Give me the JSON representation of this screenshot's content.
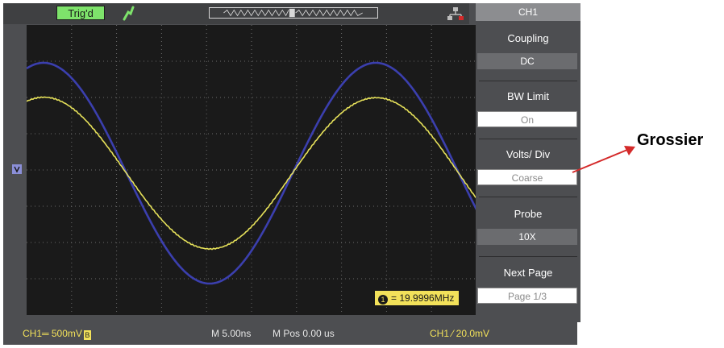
{
  "topbar": {
    "trigger_status": "Trig'd"
  },
  "menu": {
    "title": "CH1",
    "items": [
      {
        "label": "Coupling",
        "value": "DC"
      },
      {
        "label": "BW Limit",
        "value": "On"
      },
      {
        "label": "Volts/ Div",
        "value": "Coarse"
      },
      {
        "label": "Probe",
        "value": "10X"
      },
      {
        "label": "Next Page",
        "value": "Page 1/3"
      }
    ]
  },
  "readouts": {
    "frequency": "= 19.9996MHz",
    "frequency_channel": "1"
  },
  "statusbar": {
    "ch1_scale": "CH1═ 500mV",
    "bw_mark": "B",
    "timebase": "M 5.00ns",
    "horizontal_position": "M Pos 0.00 us",
    "trigger": "CH1 ⁄ 20.0mV"
  },
  "annotation": {
    "label": "Grossier"
  },
  "colors": {
    "trace_ch1": "#e6e15a",
    "trace_ref": "#3b3fae",
    "screen_bg": "#1a1a1a",
    "frame": "#4d4e51",
    "trigger_indicator": "#7ee36b",
    "arrow": "#d42a2a"
  }
}
